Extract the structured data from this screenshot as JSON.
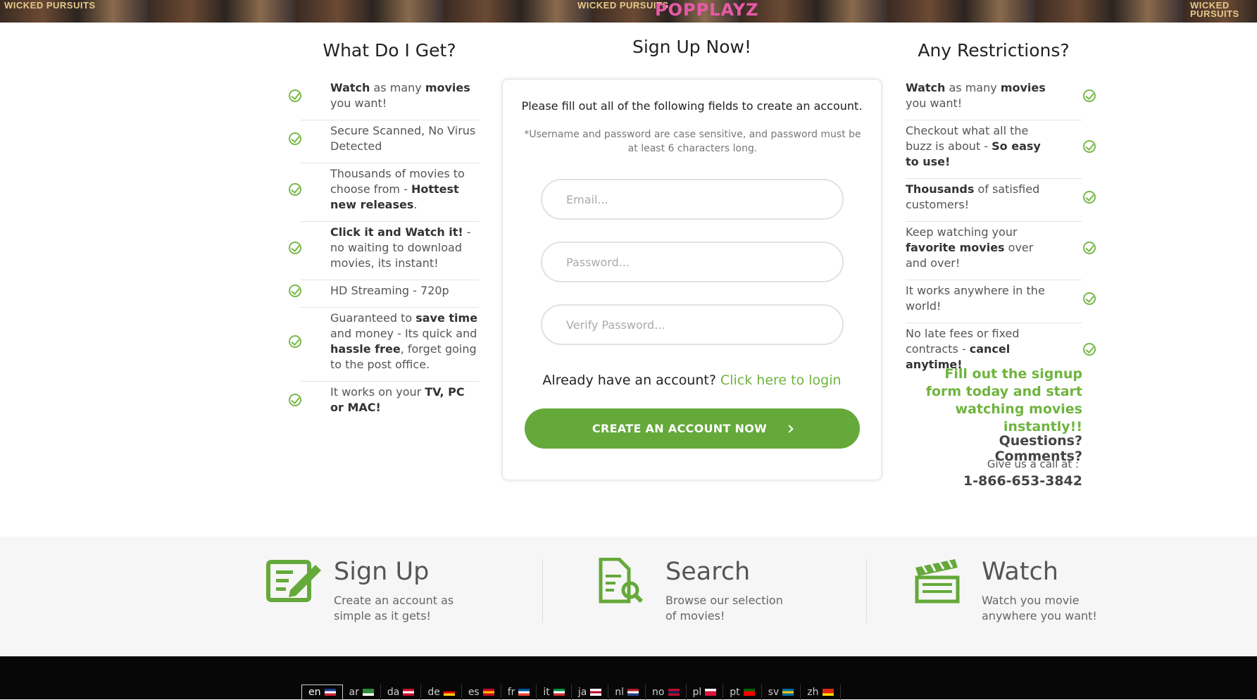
{
  "banner": {
    "tiles": [
      "WICKED PURSUITS",
      "WICKED PURSUITS",
      "WICKED PURSUITS"
    ],
    "logo": "POPPLAYZ"
  },
  "left": {
    "title": "What Do I Get?",
    "items": [
      [
        {
          "t": "Watch",
          "b": true
        },
        {
          "t": " as many "
        },
        {
          "t": "movies",
          "b": true
        },
        {
          "t": " you want!"
        }
      ],
      [
        {
          "t": "Secure Scanned, No Virus Detected"
        }
      ],
      [
        {
          "t": "Thousands of movies to choose from - "
        },
        {
          "t": "Hottest new releases",
          "b": true
        },
        {
          "t": "."
        }
      ],
      [
        {
          "t": "Click it and Watch it!",
          "b": true
        },
        {
          "t": " - no waiting to download movies, its instant!"
        }
      ],
      [
        {
          "t": "HD Streaming - 720p"
        }
      ],
      [
        {
          "t": "Guaranteed to "
        },
        {
          "t": "save time",
          "b": true
        },
        {
          "t": " and money - Its quick and "
        },
        {
          "t": "hassle free",
          "b": true
        },
        {
          "t": ", forget going to the post office."
        }
      ],
      [
        {
          "t": "It works on your "
        },
        {
          "t": "TV, PC or MAC!",
          "b": true
        }
      ]
    ]
  },
  "center": {
    "title": "Sign Up Now!",
    "intro": "Please fill out all of the following fields to create an account.",
    "note": "*Username and password are case sensitive, and password must be at least 6 characters long.",
    "email_placeholder": "Email...",
    "password_placeholder": "Password...",
    "verify_placeholder": "Verify Password...",
    "login_prompt": "Already have an account?",
    "login_link": "Click here to login",
    "cta": "CREATE AN ACCOUNT NOW"
  },
  "right": {
    "title": "Any Restrictions?",
    "items": [
      [
        {
          "t": "Watch",
          "b": true
        },
        {
          "t": " as many "
        },
        {
          "t": "movies",
          "b": true
        },
        {
          "t": " you want!"
        }
      ],
      [
        {
          "t": "Checkout what all the buzz is about - "
        },
        {
          "t": "So easy to use!",
          "b": true
        }
      ],
      [
        {
          "t": "Thousands",
          "b": true
        },
        {
          "t": " of satisfied customers!"
        }
      ],
      [
        {
          "t": "Keep watching your "
        },
        {
          "t": "favorite movies",
          "b": true
        },
        {
          "t": " over and over!"
        }
      ],
      [
        {
          "t": "It works anywhere in the world!"
        }
      ],
      [
        {
          "t": "No late fees or fixed contracts - "
        },
        {
          "t": "cancel anytime!",
          "b": true
        }
      ]
    ],
    "promo": "Fill out the signup form today and start watching movies instantly!!",
    "questions": "Questions? Comments?",
    "give_call": "Give us a call at :",
    "phone": "1-866-653-3842"
  },
  "steps": [
    {
      "title": "Sign Up",
      "desc": "Create an account as simple as it gets!",
      "icon": "signup-form-icon"
    },
    {
      "title": "Search",
      "desc": "Browse our selection of movies!",
      "icon": "search-document-icon"
    },
    {
      "title": "Watch",
      "desc": "Watch you movie anywhere you want!",
      "icon": "clapperboard-icon"
    }
  ],
  "languages": [
    {
      "code": "en",
      "active": true,
      "colors": [
        "#1f3b8f",
        "#ffffff",
        "#cc2233"
      ]
    },
    {
      "code": "ar",
      "colors": [
        "#2e8b3a",
        "#2e8b3a",
        "#ffffff"
      ]
    },
    {
      "code": "da",
      "colors": [
        "#c8102e",
        "#ffffff",
        "#c8102e"
      ]
    },
    {
      "code": "de",
      "colors": [
        "#000000",
        "#dd0000",
        "#ffce00"
      ]
    },
    {
      "code": "es",
      "colors": [
        "#c60b1e",
        "#ffc400",
        "#c60b1e"
      ]
    },
    {
      "code": "fr",
      "colors": [
        "#0055a4",
        "#ffffff",
        "#ef4135"
      ]
    },
    {
      "code": "it",
      "colors": [
        "#009246",
        "#ffffff",
        "#ce2b37"
      ]
    },
    {
      "code": "ja",
      "colors": [
        "#ffffff",
        "#bc002d",
        "#ffffff"
      ]
    },
    {
      "code": "nl",
      "colors": [
        "#ae1c28",
        "#ffffff",
        "#21468b"
      ]
    },
    {
      "code": "no",
      "colors": [
        "#ba0c2f",
        "#00205b",
        "#ba0c2f"
      ]
    },
    {
      "code": "pl",
      "colors": [
        "#ffffff",
        "#dc143c",
        "#dc143c"
      ]
    },
    {
      "code": "pt",
      "colors": [
        "#006600",
        "#ff0000",
        "#ff0000"
      ]
    },
    {
      "code": "sv",
      "colors": [
        "#006aa7",
        "#fecc00",
        "#006aa7"
      ]
    },
    {
      "code": "zh",
      "colors": [
        "#de2910",
        "#de2910",
        "#ffde00"
      ]
    }
  ],
  "colors": {
    "accent": "#64a93a",
    "accent_text": "#6fb43f"
  }
}
